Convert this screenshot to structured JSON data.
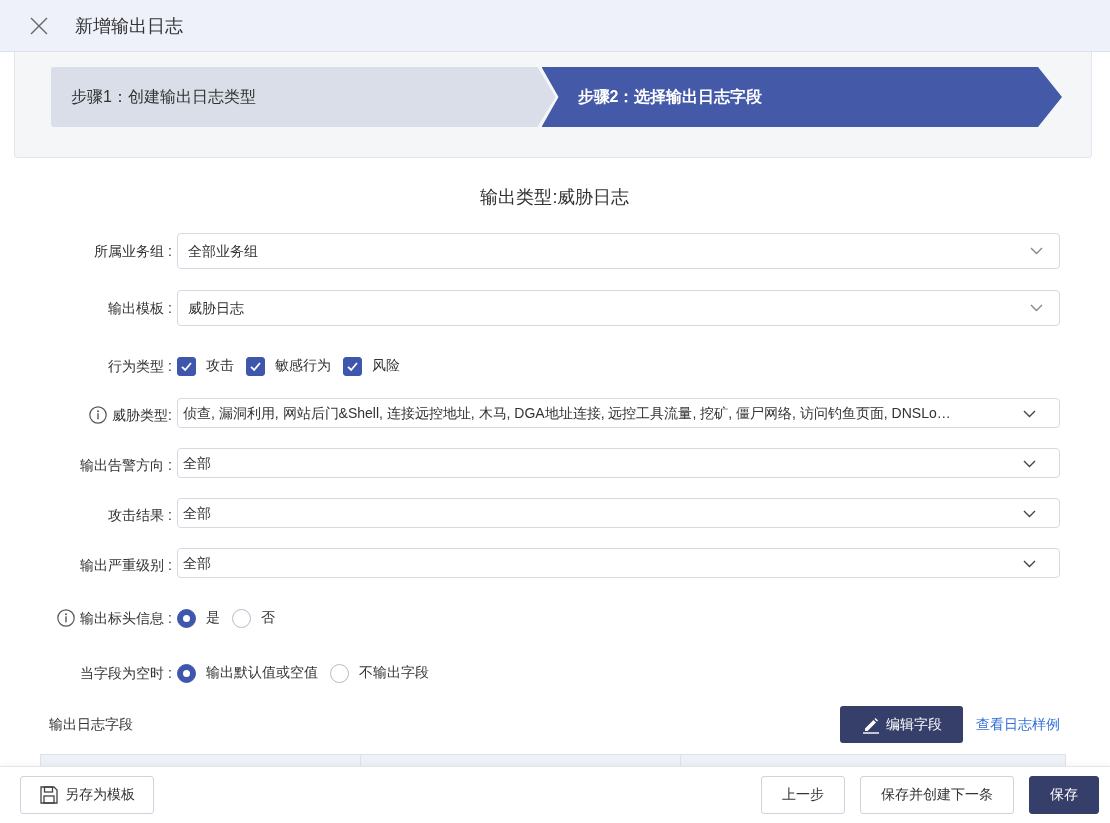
{
  "dialog": {
    "title": "新增输出日志"
  },
  "steps": [
    {
      "label": "步骤1：创建输出日志类型",
      "selected": false
    },
    {
      "label": "步骤2：选择输出日志字段",
      "selected": true
    }
  ],
  "section_title": "输出类型:威胁日志",
  "form": [
    {
      "kind": "select",
      "label": "所属业务组 :",
      "info": false,
      "value": "全部业务组"
    },
    {
      "kind": "select",
      "label": "输出模板 :",
      "info": false,
      "value": "威胁日志"
    },
    {
      "kind": "checkboxes",
      "label": "行为类型 :",
      "info": false,
      "options": [
        {
          "label": "攻击",
          "checked": true
        },
        {
          "label": "敏感行为",
          "checked": true
        },
        {
          "label": "风险",
          "checked": true
        }
      ]
    },
    {
      "kind": "compact",
      "label": "威胁类型:",
      "info": true,
      "value": "侦查, 漏洞利用, 网站后门&Shell, 连接远控地址, 木马, DGA地址连接, 远控工具流量, 挖矿, 僵尸网络, 访问钓鱼页面, DNSLo…"
    },
    {
      "kind": "compact",
      "label": "输出告警方向 :",
      "info": false,
      "value": "全部"
    },
    {
      "kind": "compact",
      "label": "攻击结果 :",
      "info": false,
      "value": "全部"
    },
    {
      "kind": "compact",
      "label": "输出严重级别 :",
      "info": false,
      "value": "全部"
    },
    {
      "kind": "radios",
      "label": "输出标头信息 :",
      "info": true,
      "options": [
        {
          "label": "是",
          "selected": true
        },
        {
          "label": "否",
          "selected": false
        }
      ]
    },
    {
      "kind": "radios",
      "label": "当字段为空时 :",
      "info": false,
      "options": [
        {
          "label": "输出默认值或空值",
          "selected": true
        },
        {
          "label": "不输出字段",
          "selected": false
        }
      ]
    }
  ],
  "log_fields": {
    "title": "输出日志字段",
    "edit_button": "编辑字段",
    "sample_link": "查看日志样例"
  },
  "footer": {
    "template_button": "另存为模板",
    "buttons": [
      {
        "label": "上一步",
        "primary": false
      },
      {
        "label": "保存并创建下一条",
        "primary": false
      },
      {
        "label": "保存",
        "primary": true
      }
    ]
  }
}
